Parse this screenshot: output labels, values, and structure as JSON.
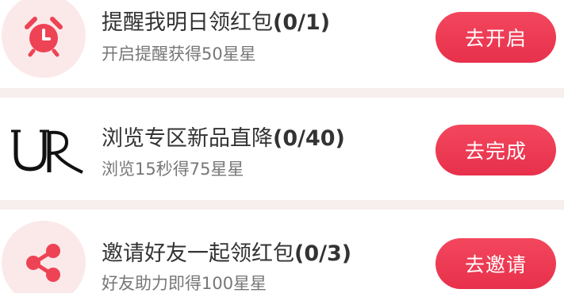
{
  "tasks": [
    {
      "title": "提醒我明日领红包",
      "count": "(0/1)",
      "subtitle": "开启提醒获得50星星",
      "button_label": "去开启",
      "icon": "alarm-clock-icon"
    },
    {
      "title": "浏览专区新品直降",
      "count": "(0/40)",
      "subtitle": "浏览15秒得75星星",
      "button_label": "去完成",
      "icon": "ur-brand-logo"
    },
    {
      "title": "邀请好友一起领红包",
      "count": "(0/3)",
      "subtitle": "好友助力即得100星星",
      "button_label": "去邀请",
      "icon": "share-icon"
    }
  ],
  "colors": {
    "accent": "#e8304b",
    "icon_bg": "#fbe9ea",
    "icon_fg": "#ee4355",
    "divider": "#f7eeee"
  }
}
